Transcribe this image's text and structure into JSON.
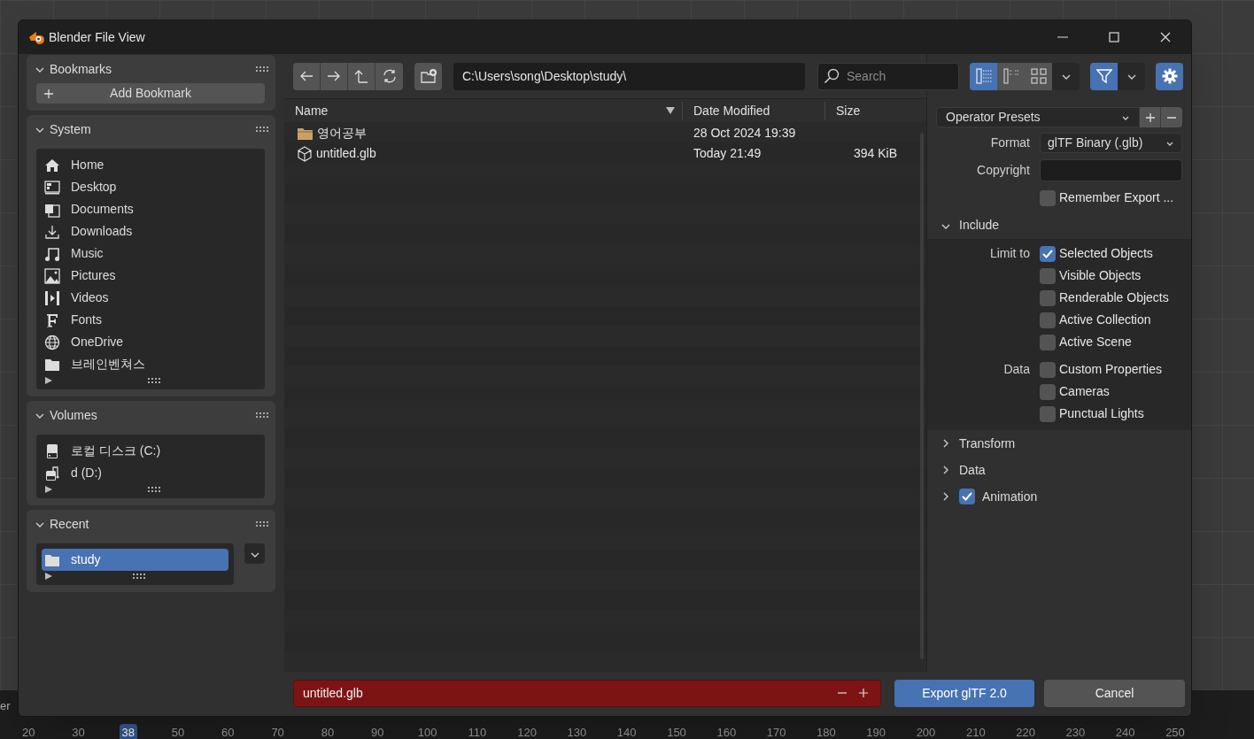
{
  "window": {
    "title": "Blender File View"
  },
  "sidebar": {
    "panels": [
      {
        "title": "Bookmarks",
        "expanded": true,
        "button": "Add Bookmark"
      },
      {
        "title": "System",
        "expanded": true,
        "items": [
          {
            "kind": "home",
            "label": "Home",
            "selected": false
          },
          {
            "kind": "desktop",
            "label": "Desktop",
            "selected": false
          },
          {
            "kind": "documents",
            "label": "Documents",
            "selected": false
          },
          {
            "kind": "downloads",
            "label": "Downloads",
            "selected": false
          },
          {
            "kind": "music",
            "label": "Music",
            "selected": false
          },
          {
            "kind": "pictures",
            "label": "Pictures",
            "selected": false
          },
          {
            "kind": "videos",
            "label": "Videos",
            "selected": false
          },
          {
            "kind": "fonts",
            "label": "Fonts",
            "selected": false
          },
          {
            "kind": "globe",
            "label": "OneDrive",
            "selected": false
          },
          {
            "kind": "folder",
            "label": "브레인벤쳐스",
            "selected": false
          }
        ]
      },
      {
        "title": "Volumes",
        "expanded": true,
        "items": [
          {
            "kind": "disk",
            "label": "로컬 디스크 (C:)",
            "selected": false
          },
          {
            "kind": "external",
            "label": "d (D:)",
            "selected": false
          }
        ]
      },
      {
        "title": "Recent",
        "expanded": true,
        "menu": true,
        "items": [
          {
            "kind": "folder",
            "label": "study",
            "selected": true
          }
        ]
      }
    ]
  },
  "toolbar": {
    "path": "C:\\Users\\song\\Desktop\\study\\",
    "search_placeholder": "Search",
    "view_modes": [
      {
        "kind": "vertical",
        "selected": true
      },
      {
        "kind": "horizontal",
        "selected": false
      },
      {
        "kind": "thumbnails",
        "selected": false
      }
    ],
    "filter_on": true,
    "settings_on": true
  },
  "file_list": {
    "columns": [
      "Name",
      "Date Modified",
      "Size"
    ],
    "rows": [
      {
        "kind": "folder",
        "name": "영어공부",
        "date": "28 Oct 2024 19:39",
        "size": ""
      },
      {
        "kind": "file",
        "name": "untitled.glb",
        "date": "Today 21:49",
        "size": "394 KiB"
      }
    ]
  },
  "options": {
    "presets": "Operator Presets",
    "format_label": "Format",
    "format_value": "glTF Binary (.glb)",
    "copyright_label": "Copyright",
    "remember": {
      "label": "Remember Export ...",
      "checked": false
    },
    "include": {
      "title": "Include",
      "expanded": true,
      "groups": [
        {
          "label": "Limit to",
          "items": [
            {
              "label": "Selected Objects",
              "checked": true
            },
            {
              "label": "Visible Objects",
              "checked": false
            },
            {
              "label": "Renderable Objects",
              "checked": false
            },
            {
              "label": "Active Collection",
              "checked": false
            },
            {
              "label": "Active Scene",
              "checked": false
            }
          ]
        },
        {
          "label": "Data",
          "items": [
            {
              "label": "Custom Properties",
              "checked": false
            },
            {
              "label": "Cameras",
              "checked": false
            },
            {
              "label": "Punctual Lights",
              "checked": false
            }
          ]
        }
      ]
    },
    "sections": [
      {
        "title": "Transform",
        "expanded": false
      },
      {
        "title": "Data",
        "expanded": false
      },
      {
        "title": "Animation",
        "expanded": false,
        "checked": true
      }
    ]
  },
  "footer": {
    "filename": "untitled.glb",
    "confirm": "Export glTF 2.0",
    "cancel": "Cancel"
  },
  "timeline": {
    "label": "er",
    "current": "38",
    "ticks_before": [
      "20",
      "30"
    ],
    "ticks_after": [
      "50",
      "60",
      "70",
      "80",
      "90",
      "100",
      "110",
      "120",
      "130",
      "140",
      "150",
      "160",
      "170",
      "180",
      "190",
      "200",
      "210",
      "220",
      "230",
      "240",
      "250"
    ]
  }
}
